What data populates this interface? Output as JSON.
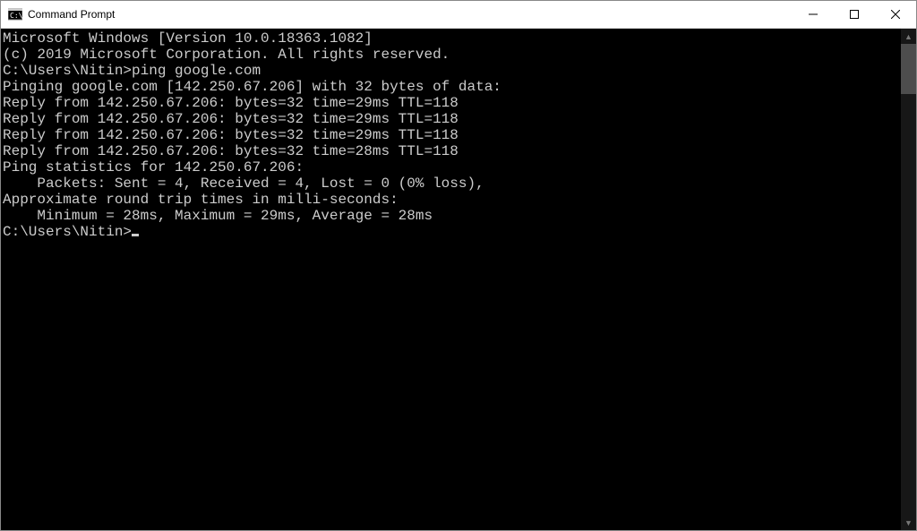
{
  "window": {
    "title": "Command Prompt"
  },
  "terminal": {
    "header1": "Microsoft Windows [Version 10.0.18363.1082]",
    "header2": "(c) 2019 Microsoft Corporation. All rights reserved.",
    "blank": "",
    "prompt1": "C:\\Users\\Nitin>ping google.com",
    "pinging": "Pinging google.com [142.250.67.206] with 32 bytes of data:",
    "reply1": "Reply from 142.250.67.206: bytes=32 time=29ms TTL=118",
    "reply2": "Reply from 142.250.67.206: bytes=32 time=29ms TTL=118",
    "reply3": "Reply from 142.250.67.206: bytes=32 time=29ms TTL=118",
    "reply4": "Reply from 142.250.67.206: bytes=32 time=28ms TTL=118",
    "statsHeader": "Ping statistics for 142.250.67.206:",
    "statsPackets": "    Packets: Sent = 4, Received = 4, Lost = 0 (0% loss),",
    "rttHeader": "Approximate round trip times in milli-seconds:",
    "rttValues": "    Minimum = 28ms, Maximum = 29ms, Average = 28ms",
    "prompt2": "C:\\Users\\Nitin>"
  }
}
